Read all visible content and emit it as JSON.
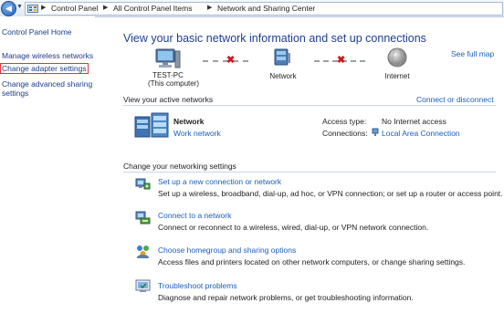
{
  "address_bar": {
    "back_icon": "back-arrow-icon",
    "breadcrumb": [
      "Control Panel",
      "All Control Panel Items",
      "Network and Sharing Center"
    ]
  },
  "sidebar": {
    "items": [
      {
        "label": "Control Panel Home"
      },
      {
        "label": "Manage wireless networks"
      },
      {
        "label": "Change adapter settings",
        "highlighted": true
      },
      {
        "label_line1": "Change advanced sharing",
        "label_line2": "settings"
      }
    ]
  },
  "main": {
    "title": "View your basic network information and set up connections",
    "see_full_map": "See full map",
    "map": {
      "computer": {
        "name": "TEST-PC",
        "sub": "(This computer)",
        "icon": "computer-icon"
      },
      "network": {
        "name": "Network",
        "icon": "network-icon"
      },
      "internet": {
        "name": "Internet",
        "icon": "globe-icon"
      },
      "broken_icon": "red-x-icon"
    },
    "active_networks": {
      "heading": "View your active networks",
      "connect_link": "Connect or disconnect",
      "network_name": "Network",
      "network_type": "Work network",
      "access_type_label": "Access type:",
      "access_type_value": "No Internet access",
      "connections_label": "Connections:",
      "connections_value": "Local Area Connection"
    },
    "change_settings": {
      "heading": "Change your networking settings",
      "tasks": [
        {
          "title": "Set up a new connection or network",
          "desc": "Set up a wireless, broadband, dial-up, ad hoc, or VPN connection; or set up a router or access point.",
          "icon": "new-connection-icon"
        },
        {
          "title": "Connect to a network",
          "desc": "Connect or reconnect to a wireless, wired, dial-up, or VPN network connection.",
          "icon": "connect-network-icon"
        },
        {
          "title": "Choose homegroup and sharing options",
          "desc": "Access files and printers located on other network computers, or change sharing settings.",
          "icon": "homegroup-icon"
        },
        {
          "title": "Troubleshoot problems",
          "desc": "Diagnose and repair network problems, or get troubleshooting information.",
          "icon": "troubleshoot-icon"
        }
      ]
    }
  },
  "colors": {
    "link": "#1a5fc0",
    "title": "#1e3f8f",
    "highlight_border": "#e0343a",
    "error_x": "#d01717"
  }
}
